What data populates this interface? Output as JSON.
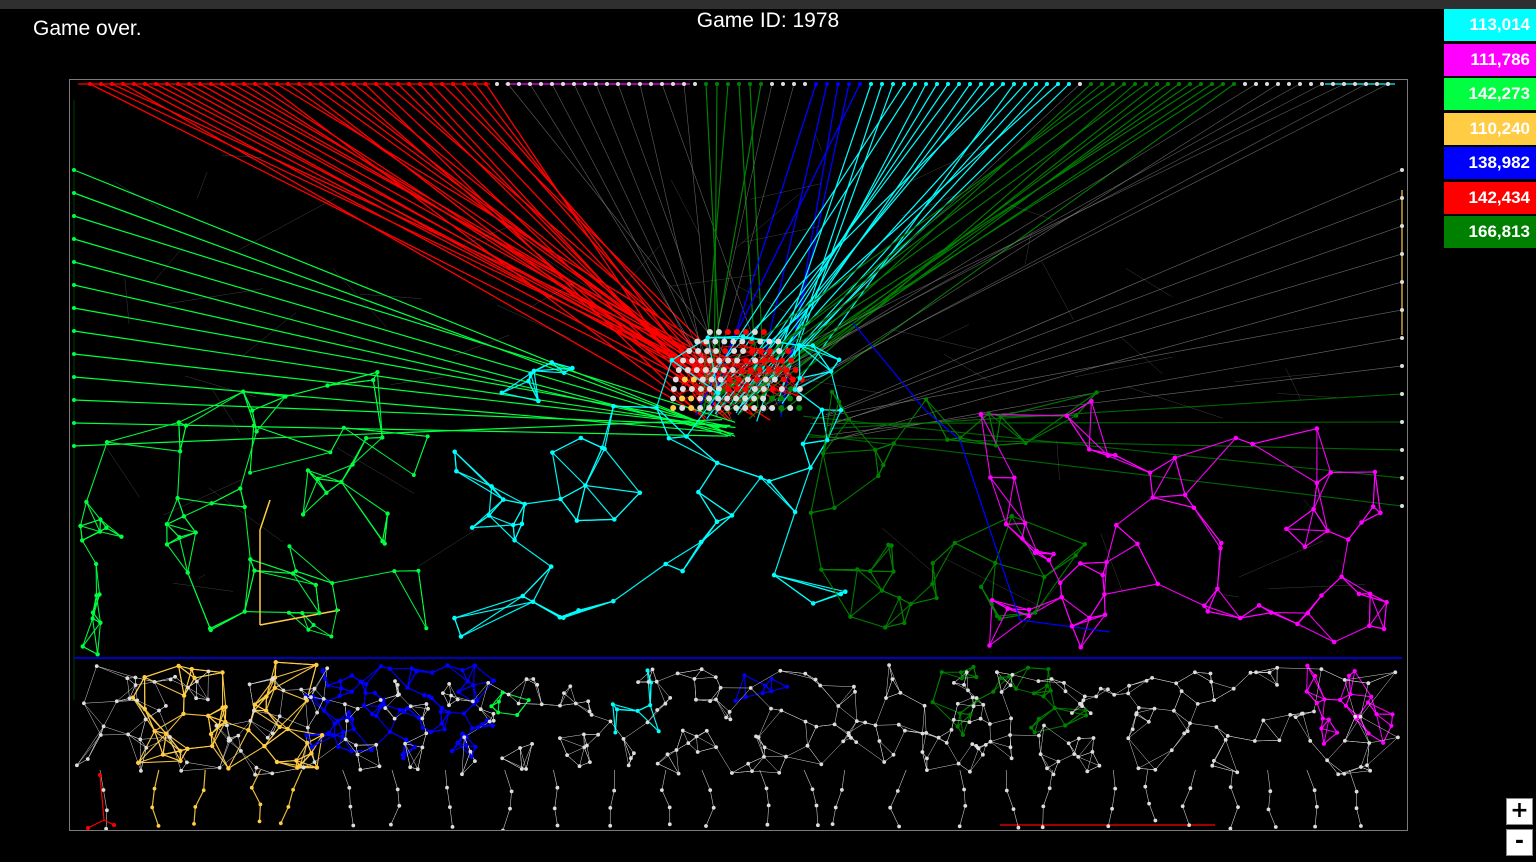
{
  "status_text": "Game over.",
  "game_id_text": "Game ID: 1978",
  "scores": [
    {
      "value": "113,014",
      "color": "#00ffff"
    },
    {
      "value": "111,786",
      "color": "#ff00ff"
    },
    {
      "value": "142,273",
      "color": "#00ff40"
    },
    {
      "value": "110,240",
      "color": "#ffcc44"
    },
    {
      "value": "138,982",
      "color": "#0000ff"
    },
    {
      "value": "142,434",
      "color": "#ff0000"
    },
    {
      "value": "166,813",
      "color": "#008000"
    }
  ],
  "zoom": {
    "in_label": "+",
    "out_label": "-"
  },
  "board": {
    "background": "#000000",
    "border_color": "#7a7a7a",
    "neutral_color": "#dddddd"
  }
}
